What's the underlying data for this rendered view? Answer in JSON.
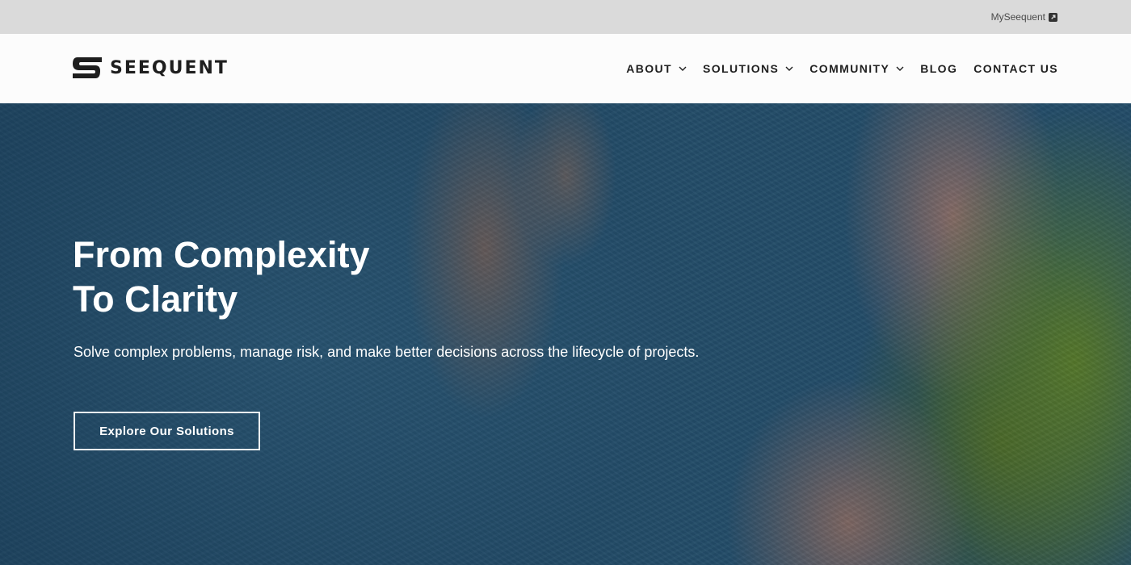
{
  "utility_bar": {
    "myseequent_label": "MySeequent",
    "myseequent_icon": "external-link-icon"
  },
  "header": {
    "logo_text": "SEEQUENT",
    "nav": [
      {
        "label": "ABOUT",
        "has_dropdown": true
      },
      {
        "label": "SOLUTIONS",
        "has_dropdown": true
      },
      {
        "label": "COMMUNITY",
        "has_dropdown": true
      },
      {
        "label": "BLOG",
        "has_dropdown": false
      },
      {
        "label": "CONTACT US",
        "has_dropdown": false
      }
    ]
  },
  "hero": {
    "title": "From Complexity\nTo Clarity",
    "subtitle": "Solve complex problems, manage risk, and make better decisions across the lifecycle of projects.",
    "cta_label": "Explore Our Solutions"
  },
  "colors": {
    "utility_bar_bg": "#dadada",
    "header_bg": "#fcfcfc",
    "nav_text": "#1f1f1f",
    "hero_text": "#ffffff"
  }
}
